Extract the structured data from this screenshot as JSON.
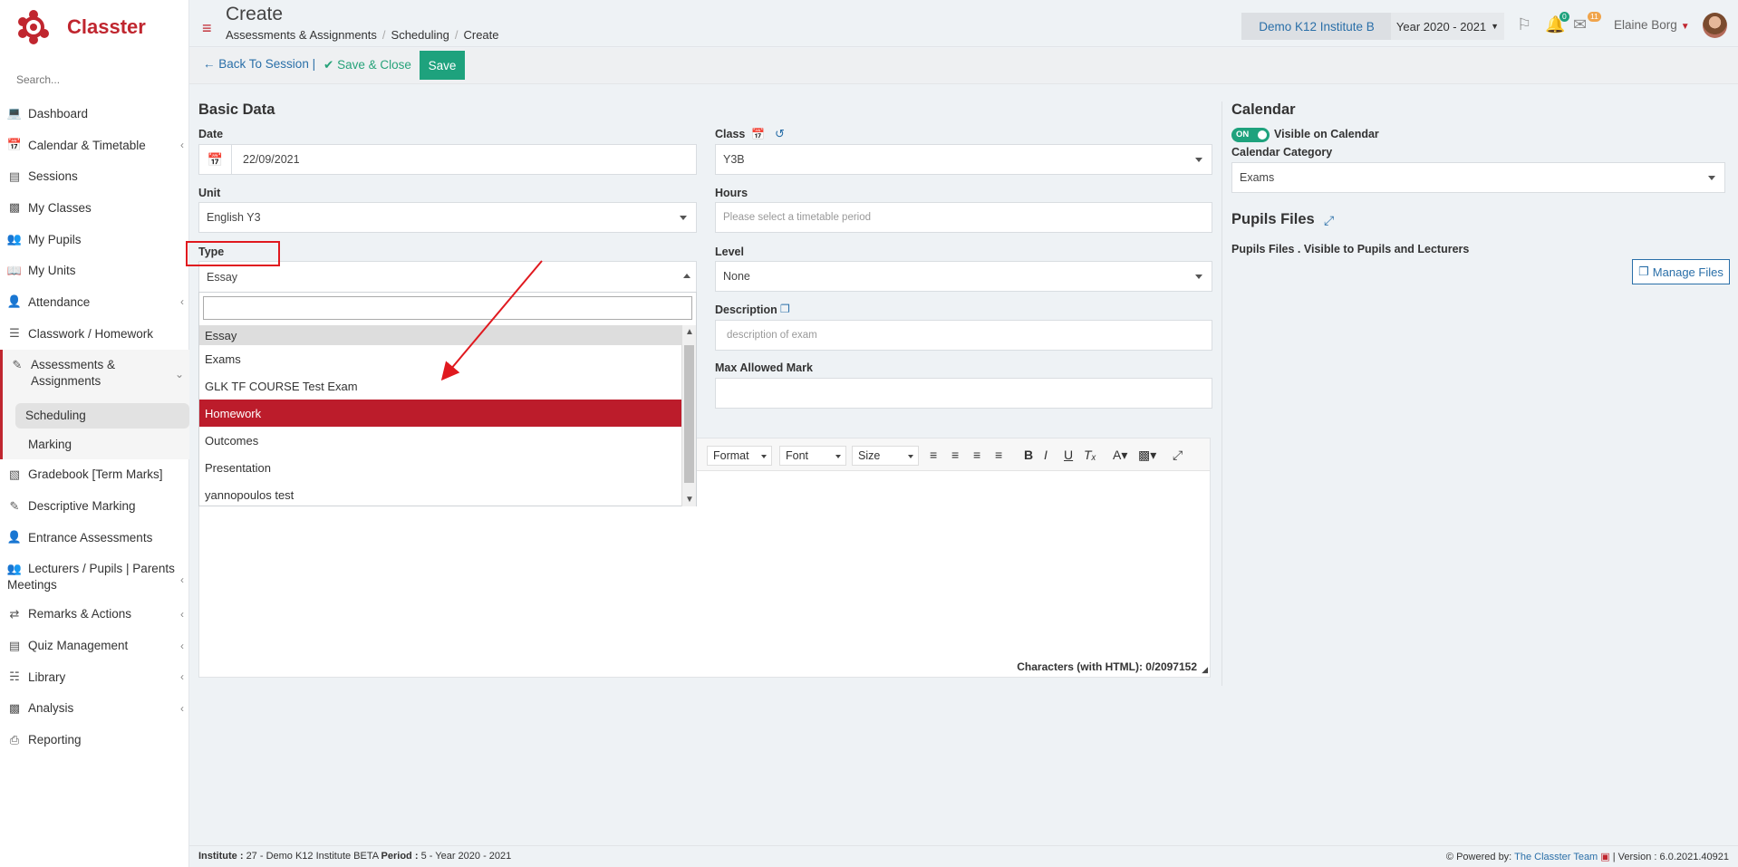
{
  "brand": {
    "name": "Classter",
    "color": "#c0262f"
  },
  "sidebar": {
    "search_placeholder": "Search...",
    "items": [
      {
        "label": "Dashboard",
        "icon": "laptop-icon"
      },
      {
        "label": "Calendar & Timetable",
        "icon": "calendar-icon",
        "has_children": true
      },
      {
        "label": "Sessions",
        "icon": "sessions-icon"
      },
      {
        "label": "My Classes",
        "icon": "classes-icon"
      },
      {
        "label": "My Pupils",
        "icon": "pupils-icon"
      },
      {
        "label": "My Units",
        "icon": "book-icon"
      },
      {
        "label": "Attendance",
        "icon": "attendance-icon",
        "has_children": true
      },
      {
        "label": "Classwork / Homework",
        "icon": "list-icon"
      },
      {
        "label": "Assessments & Assignments",
        "icon": "edit-icon",
        "has_children": true,
        "active": true
      },
      {
        "label": "Scheduling",
        "sub": true,
        "selected": true
      },
      {
        "label": "Marking",
        "sub": true
      },
      {
        "label": "Gradebook [Term Marks]",
        "icon": "gradebook-icon"
      },
      {
        "label": "Descriptive Marking",
        "icon": "descriptive-icon"
      },
      {
        "label": "Entrance Assessments",
        "icon": "entrance-icon"
      },
      {
        "label": "Lecturers / Pupils | Parents Meetings",
        "icon": "meetings-icon",
        "has_children": true
      },
      {
        "label": "Remarks & Actions",
        "icon": "remarks-icon",
        "has_children": true
      },
      {
        "label": "Quiz Management",
        "icon": "quiz-icon",
        "has_children": true
      },
      {
        "label": "Library",
        "icon": "library-icon",
        "has_children": true
      },
      {
        "label": "Analysis",
        "icon": "analysis-icon",
        "has_children": true
      },
      {
        "label": "Reporting",
        "icon": "printer-icon"
      }
    ]
  },
  "header": {
    "title": "Create",
    "breadcrumb": [
      "Assessments & Assignments",
      "Scheduling",
      "Create"
    ],
    "institute": "Demo K12 Institute B",
    "year": "Year 2020 - 2021",
    "notifications_count": "0",
    "messages_count": "11",
    "user_name": "Elaine Borg"
  },
  "toolbar": {
    "back_label": "Back To Session |",
    "save_close_label": "Save & Close",
    "save_label": "Save"
  },
  "form": {
    "basic_data_title": "Basic Data",
    "date_label": "Date",
    "date_value": "22/09/2021",
    "class_label": "Class",
    "class_value": "Y3B",
    "unit_label": "Unit",
    "unit_value": "English Y3",
    "hours_label": "Hours",
    "hours_placeholder": "Please select a timetable period",
    "type_label": "Type",
    "type_value": "Essay",
    "level_label": "Level",
    "level_value": "None",
    "description_label": "Description",
    "description_placeholder": "description of exam",
    "max_mark_label": "Max Allowed Mark",
    "type_options": [
      "Essay",
      "Exams",
      "GLK TF COURSE Test Exam",
      "Homework",
      "Outcomes",
      "Presentation",
      "yannopoulos test"
    ],
    "type_highlighted": "Homework"
  },
  "editor": {
    "format_label": "Format",
    "font_label": "Font",
    "size_label": "Size",
    "char_count": "Characters (with HTML): 0/2097152"
  },
  "calendar": {
    "title": "Calendar",
    "toggle_text": "ON",
    "visible_label": "Visible on Calendar",
    "category_label": "Calendar Category",
    "category_value": "Exams"
  },
  "pupils_files": {
    "title": "Pupils Files",
    "description": "Pupils Files . Visible to Pupils and Lecturers",
    "manage_label": "Manage Files"
  },
  "footer": {
    "institute_label": "Institute :",
    "institute_value": "27 - Demo K12 Institute BETA",
    "period_label": "Period :",
    "period_value": "5 - Year 2020 - 2021",
    "powered_label": "Powered by:",
    "powered_link": "The Classter Team",
    "version": "| Version : 6.0.2021.40921"
  },
  "colors": {
    "accent_red": "#bc1c2b",
    "save_green": "#1ea27d",
    "link_blue": "#2a6fa8",
    "annotation_red": "#e0191f"
  }
}
